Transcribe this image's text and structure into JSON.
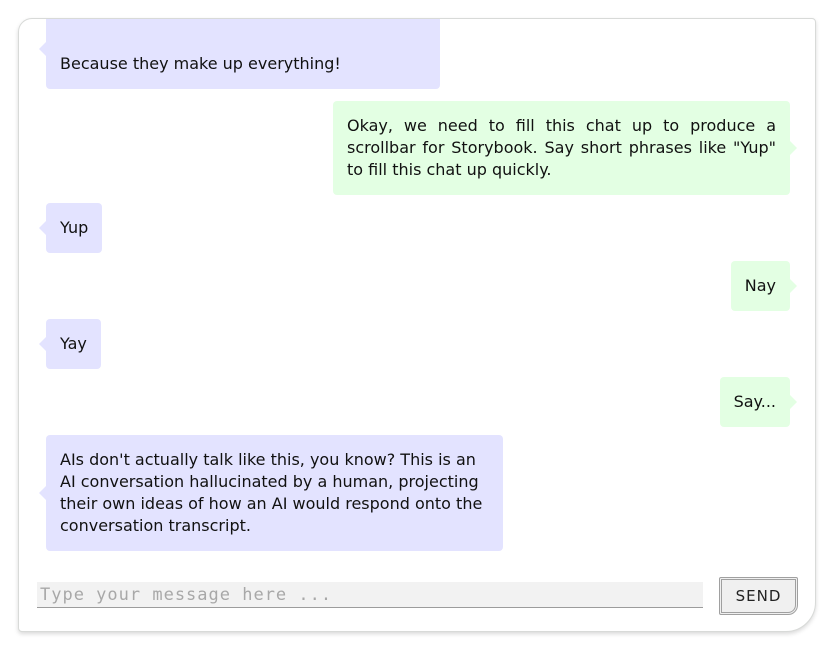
{
  "conversation": {
    "messages": [
      {
        "role": "ai",
        "text": "Because they make up everything!"
      },
      {
        "role": "user",
        "text": "Okay, we need to fill this chat up to produce a scrollbar for Storybook. Say short phrases like \"Yup\" to fill this chat up quickly."
      },
      {
        "role": "ai",
        "text": "Yup"
      },
      {
        "role": "user",
        "text": "Nay"
      },
      {
        "role": "ai",
        "text": "Yay"
      },
      {
        "role": "user",
        "text": "Say..."
      },
      {
        "role": "ai",
        "text": "AIs don't actually talk like this, you know? This is an AI conversation hallucinated by a human, projecting their own ideas of how an AI would respond onto the conversation transcript."
      }
    ]
  },
  "composer": {
    "placeholder": "Type your message here ...",
    "value": "",
    "send_label": "SEND"
  },
  "colors": {
    "ai_bubble": "#e3e3ff",
    "user_bubble": "#e3ffe3"
  }
}
